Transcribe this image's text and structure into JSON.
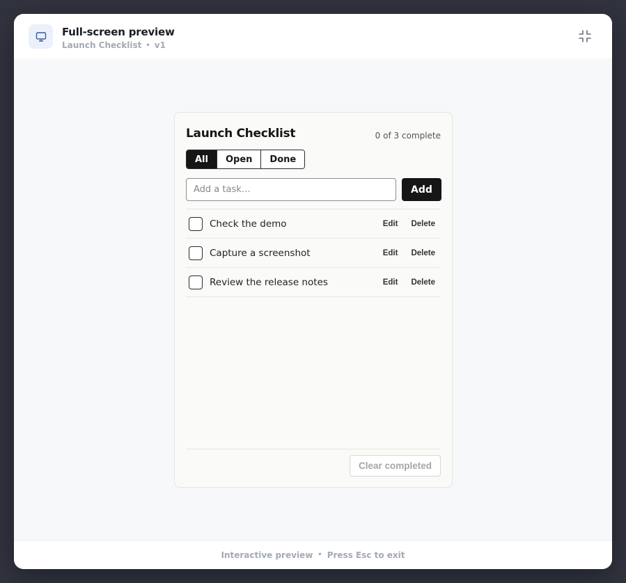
{
  "header": {
    "title": "Full-screen preview",
    "subtitle_name": "Launch Checklist",
    "subtitle_separator": "•",
    "subtitle_version": "v1",
    "icon": "monitor-icon",
    "exit_icon": "exit-fullscreen-icon"
  },
  "card": {
    "title": "Launch Checklist",
    "progress": "0 of 3 complete",
    "filters": [
      {
        "label": "All",
        "active": true
      },
      {
        "label": "Open",
        "active": false
      },
      {
        "label": "Done",
        "active": false
      }
    ],
    "input_placeholder": "Add a task…",
    "add_label": "Add",
    "tasks": [
      {
        "text": "Check the demo",
        "done": false,
        "edit": "Edit",
        "delete": "Delete"
      },
      {
        "text": "Capture a screenshot",
        "done": false,
        "edit": "Edit",
        "delete": "Delete"
      },
      {
        "text": "Review the release notes",
        "done": false,
        "edit": "Edit",
        "delete": "Delete"
      }
    ],
    "clear_label": "Clear completed"
  },
  "footer": {
    "left": "Interactive preview",
    "separator": "•",
    "right": "Press Esc to exit"
  },
  "colors": {
    "backdrop": "#31333f",
    "accent": "#161616",
    "muted": "#a3aab6",
    "icon_tint": "#3b5b9a"
  }
}
